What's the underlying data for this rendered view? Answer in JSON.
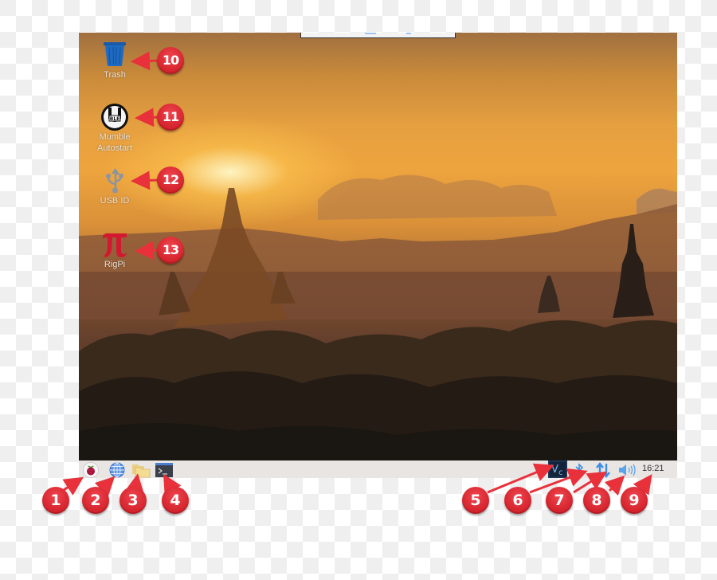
{
  "desktop": {
    "icons": [
      {
        "label": "Trash",
        "icon": "trash-icon",
        "callout": "10"
      },
      {
        "label": "Mumble\nAutostart",
        "label_line1": "Mumble",
        "label_line2": "Autostart",
        "icon": "mumble-icon",
        "callout": "11"
      },
      {
        "label": "USB ID",
        "icon": "usb-icon",
        "callout": "12"
      },
      {
        "label": "RigPi",
        "icon": "pi-icon",
        "callout": "13"
      }
    ]
  },
  "taskbar": {
    "launchers": [
      {
        "name": "menu",
        "icon": "raspberry-icon",
        "callout": "1"
      },
      {
        "name": "web-browser",
        "icon": "globe-icon",
        "callout": "2"
      },
      {
        "name": "file-manager",
        "icon": "folder-icon",
        "callout": "3"
      },
      {
        "name": "terminal",
        "icon": "terminal-icon",
        "callout": "4",
        "glyph": ">_"
      }
    ],
    "tray": [
      {
        "name": "vnc",
        "icon": "vnc-icon",
        "callout": "5",
        "glyph": "Vc"
      },
      {
        "name": "bluetooth",
        "icon": "bluetooth-icon",
        "callout": "6"
      },
      {
        "name": "network",
        "icon": "network-arrows-icon",
        "callout": "7"
      },
      {
        "name": "volume",
        "icon": "volume-icon",
        "callout": "8"
      }
    ],
    "clock": {
      "time": "16:21",
      "callout": "9"
    }
  },
  "colors": {
    "callout_red": "#d92a33",
    "arrow_red": "#e8313a",
    "taskbar_bg": "#e9e5e3",
    "tray_blue": "#3a8ee6",
    "trash_blue": "#1e63b5",
    "rigpi_red": "#d2192f"
  }
}
